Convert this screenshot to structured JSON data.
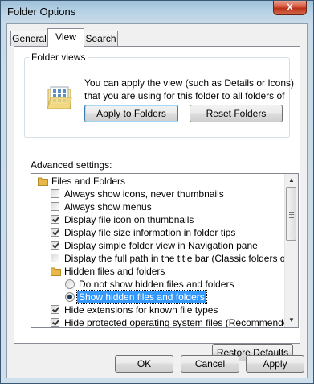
{
  "window": {
    "title": "Folder Options",
    "close_glyph": "X"
  },
  "tabs": [
    {
      "label": "General"
    },
    {
      "label": "View"
    },
    {
      "label": "Search"
    }
  ],
  "folder_views": {
    "title": "Folder views",
    "description": "You can apply the view (such as Details or Icons) that you are using for this folder to all folders of this type.",
    "apply_button": "Apply to Folders",
    "reset_button": "Reset Folders"
  },
  "advanced": {
    "label": "Advanced settings:",
    "items": [
      {
        "type": "folder",
        "label": "Files and Folders",
        "indent": 0
      },
      {
        "type": "checkbox",
        "checked": false,
        "label": "Always show icons, never thumbnails",
        "indent": 1
      },
      {
        "type": "checkbox",
        "checked": false,
        "label": "Always show menus",
        "indent": 1
      },
      {
        "type": "checkbox",
        "checked": true,
        "label": "Display file icon on thumbnails",
        "indent": 1
      },
      {
        "type": "checkbox",
        "checked": true,
        "label": "Display file size information in folder tips",
        "indent": 1
      },
      {
        "type": "checkbox",
        "checked": true,
        "label": "Display simple folder view in Navigation pane",
        "indent": 1
      },
      {
        "type": "checkbox",
        "checked": false,
        "label": "Display the full path in the title bar (Classic folders only)",
        "indent": 1
      },
      {
        "type": "folder",
        "label": "Hidden files and folders",
        "indent": 1
      },
      {
        "type": "radio",
        "checked": false,
        "label": "Do not show hidden files and folders",
        "indent": 2
      },
      {
        "type": "radio",
        "checked": true,
        "label": "Show hidden files and folders",
        "indent": 2,
        "selected": true
      },
      {
        "type": "checkbox",
        "checked": true,
        "label": "Hide extensions for known file types",
        "indent": 1
      },
      {
        "type": "checkbox",
        "checked": true,
        "label": "Hide protected operating system files (Recommended)",
        "indent": 1
      }
    ],
    "restore_button": "Restore Defaults"
  },
  "footer": {
    "ok": "OK",
    "cancel": "Cancel",
    "apply": "Apply"
  },
  "colors": {
    "selection": "#3399ff",
    "folder": "#e8b84a",
    "close": "#c8452b"
  }
}
